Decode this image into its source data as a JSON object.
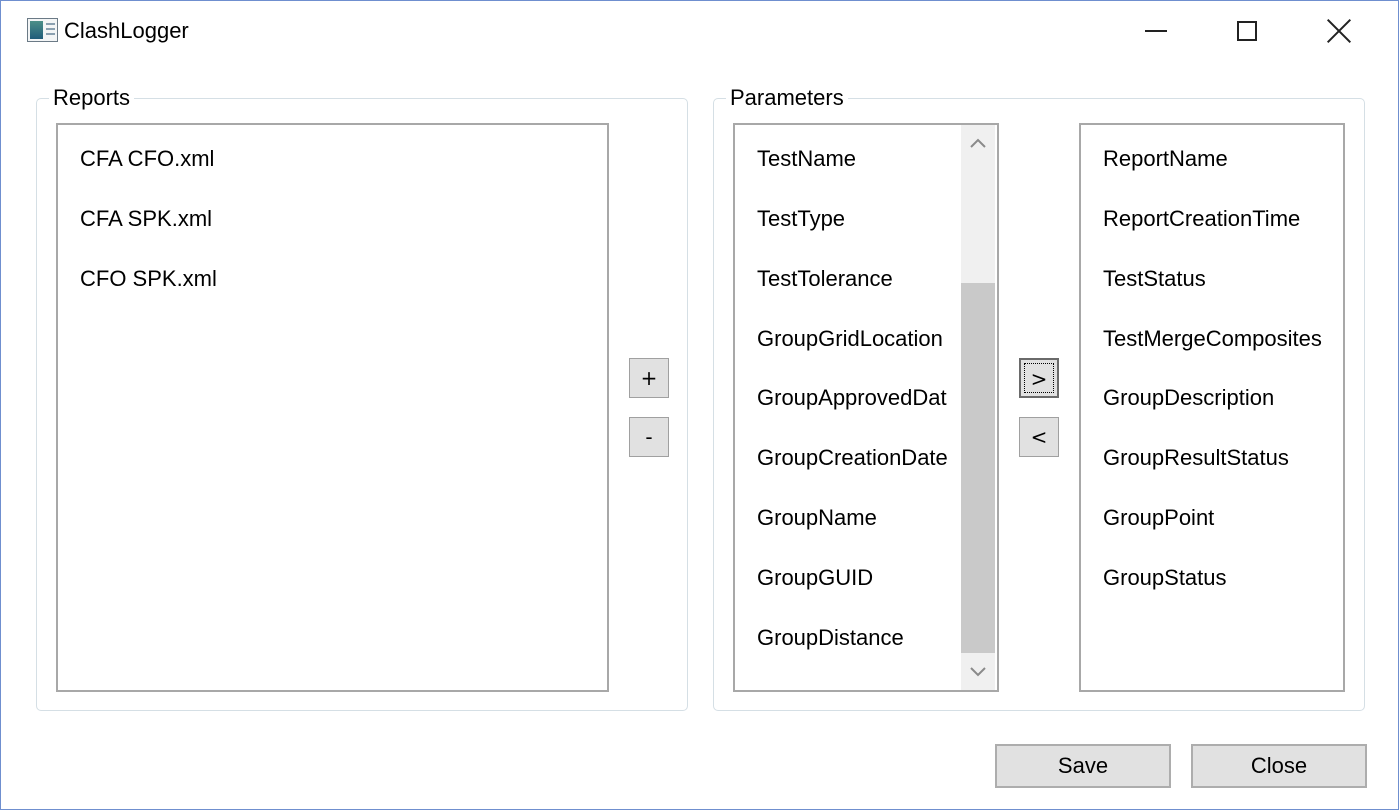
{
  "window": {
    "title": "ClashLogger",
    "controls": {
      "minimize": "minimize",
      "maximize": "maximize",
      "close": "close"
    }
  },
  "reports": {
    "label": "Reports",
    "items": [
      "CFA CFO.xml",
      "CFA SPK.xml",
      "CFO SPK.xml"
    ],
    "add_label": "+",
    "remove_label": "-"
  },
  "parameters": {
    "label": "Parameters",
    "available": [
      "TestName",
      "TestType",
      "TestTolerance",
      "GroupGridLocation",
      "GroupApprovedDat",
      "GroupCreationDate",
      "GroupName",
      "GroupGUID",
      "GroupDistance"
    ],
    "selected": [
      "ReportName",
      "ReportCreationTime",
      "TestStatus",
      "TestMergeComposites",
      "GroupDescription",
      "GroupResultStatus",
      "GroupPoint",
      "GroupStatus"
    ],
    "move_right_label": ">",
    "move_left_label": "<",
    "scroll_up_icon": "chevron-up-icon",
    "scroll_down_icon": "chevron-down-icon"
  },
  "footer": {
    "save_label": "Save",
    "close_label": "Close"
  }
}
